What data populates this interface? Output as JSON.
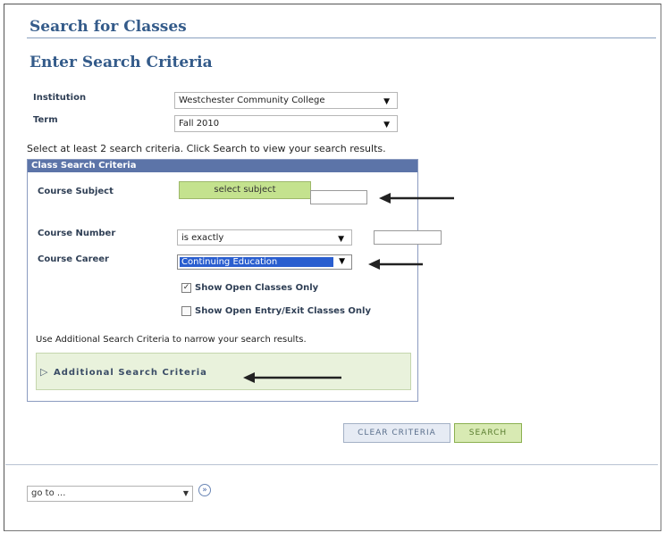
{
  "page": {
    "title": "Search for Classes",
    "section_title": "Enter Search Criteria"
  },
  "form": {
    "institution": {
      "label": "Institution",
      "value": "Westchester Community College"
    },
    "term": {
      "label": "Term",
      "value": "Fall 2010"
    },
    "instructions": "Select at least 2 search criteria. Click Search to view your search results."
  },
  "criteria": {
    "header": "Class Search Criteria",
    "course_subject": {
      "label": "Course Subject",
      "button_label": "select subject",
      "value": ""
    },
    "course_number": {
      "label": "Course Number",
      "operator": "is exactly",
      "value": ""
    },
    "course_career": {
      "label": "Course Career",
      "value": "Continuing Education"
    },
    "checkboxes": [
      {
        "label": "Show Open Classes Only",
        "checked": true
      },
      {
        "label": "Show Open Entry/Exit Classes Only",
        "checked": false
      }
    ],
    "additional_hint": "Use Additional Search Criteria to narrow your search results.",
    "additional_toggle": "Additional Search Criteria"
  },
  "actions": {
    "clear_label": "Clear Criteria",
    "search_label": "Search"
  },
  "footer": {
    "goto_value": "go to ..."
  },
  "icons": {
    "expand": "triangle-right-icon",
    "go": "double-chevron-right-icon",
    "dropdown": "triangle-down-icon"
  }
}
